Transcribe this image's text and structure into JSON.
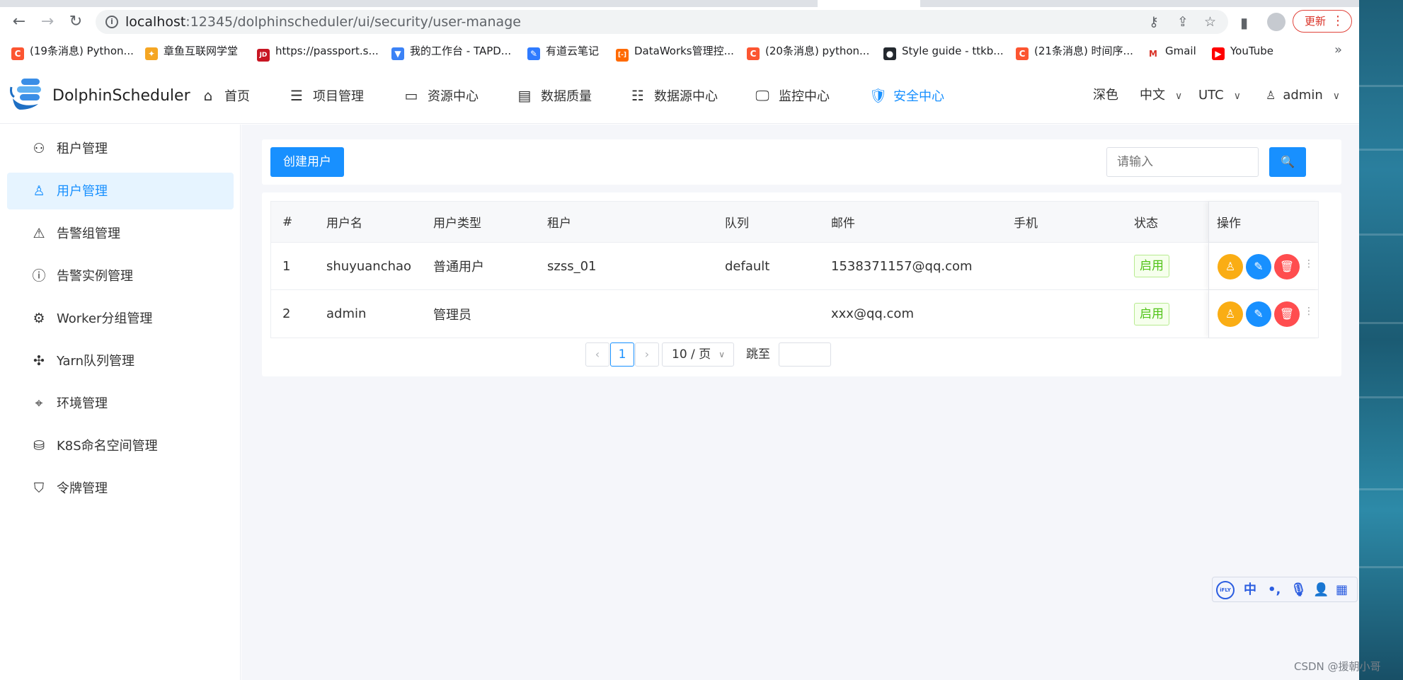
{
  "browser": {
    "nav": {
      "back": "←",
      "forward": "→",
      "reload": "↻"
    },
    "url_host": "localhost",
    "url_rest": ":12345/dolphinscheduler/ui/security/user-manage",
    "update_label": "更新",
    "bookmarks": [
      {
        "label": "(19条消息) Python...",
        "color": "#fc5531",
        "glyph": "C"
      },
      {
        "label": "章鱼互联网学堂",
        "color": "#f5a623",
        "glyph": "✦"
      },
      {
        "label": "https://passport.s...",
        "color": "#c81623",
        "glyph": "JD"
      },
      {
        "label": "我的工作台 - TAPD...",
        "color": "#3b82f6",
        "glyph": "▼"
      },
      {
        "label": "有道云笔记",
        "color": "#2f7bff",
        "glyph": "✎"
      },
      {
        "label": "DataWorks管理控...",
        "color": "#ff6a00",
        "glyph": "[-]"
      },
      {
        "label": "(20条消息) python...",
        "color": "#fc5531",
        "glyph": "C"
      },
      {
        "label": "Style guide - ttkb...",
        "color": "#24292f",
        "glyph": "●"
      },
      {
        "label": "(21条消息) 时间序...",
        "color": "#fc5531",
        "glyph": "C"
      },
      {
        "label": "Gmail",
        "color": "#ffffff",
        "glyph": "M"
      },
      {
        "label": "YouTube",
        "color": "#ff0000",
        "glyph": "▶"
      }
    ],
    "more": "»"
  },
  "app": {
    "brand": "DolphinScheduler",
    "nav": [
      {
        "label": "首页",
        "icon": "home-icon",
        "glyph": "⌂"
      },
      {
        "label": "项目管理",
        "icon": "project-icon",
        "glyph": "☰"
      },
      {
        "label": "资源中心",
        "icon": "folder-icon",
        "glyph": "▭"
      },
      {
        "label": "数据质量",
        "icon": "data-quality-icon",
        "glyph": "▤"
      },
      {
        "label": "数据源中心",
        "icon": "datasource-icon",
        "glyph": "☷"
      },
      {
        "label": "监控中心",
        "icon": "monitor-icon",
        "glyph": "🖵"
      },
      {
        "label": "安全中心",
        "icon": "shield-icon",
        "glyph": "🛡"
      }
    ],
    "theme_label": "深色",
    "language_label": "中文",
    "timezone_label": "UTC",
    "user_label": "admin"
  },
  "sidebar": {
    "items": [
      {
        "label": "租户管理",
        "icon": "tenant-icon",
        "glyph": "⚇"
      },
      {
        "label": "用户管理",
        "icon": "user-icon",
        "glyph": "♙"
      },
      {
        "label": "告警组管理",
        "icon": "warning-icon",
        "glyph": "⚠"
      },
      {
        "label": "告警实例管理",
        "icon": "info-icon",
        "glyph": "ⓘ"
      },
      {
        "label": "Worker分组管理",
        "icon": "worker-group-icon",
        "glyph": "⚙"
      },
      {
        "label": "Yarn队列管理",
        "icon": "yarn-queue-icon",
        "glyph": "✣"
      },
      {
        "label": "环境管理",
        "icon": "location-icon",
        "glyph": "⌖"
      },
      {
        "label": "K8S命名空间管理",
        "icon": "k8s-icon",
        "glyph": "⛁"
      },
      {
        "label": "令牌管理",
        "icon": "token-icon",
        "glyph": "⛉"
      }
    ]
  },
  "toolbar": {
    "create_user_label": "创建用户",
    "search_placeholder": "请输入",
    "search_icon": "🔍"
  },
  "table": {
    "columns": [
      "#",
      "用户名",
      "用户类型",
      "租户",
      "队列",
      "邮件",
      "手机",
      "状态",
      "操作"
    ],
    "rows": [
      {
        "index": "1",
        "username": "shuyuanchao",
        "user_type": "普通用户",
        "tenant": "szss_01",
        "queue": "default",
        "email": "1538371157@qq.com",
        "phone": "",
        "status": "启用",
        "more": "⋮"
      },
      {
        "index": "2",
        "username": "admin",
        "user_type": "管理员",
        "tenant": "",
        "queue": "",
        "email": "xxx@qq.com",
        "phone": "",
        "status": "启用",
        "more": "⋮"
      }
    ],
    "action_icons": {
      "authorize": "♙",
      "edit": "✎",
      "delete": "🗑"
    }
  },
  "pagination": {
    "prev": "‹",
    "current_page": "1",
    "next": "›",
    "page_size": "10 / 页",
    "jump_label": "跳至"
  },
  "ime": {
    "logo": "iFLY",
    "zh": "中",
    "punct": "•,",
    "mic": "🎙",
    "user": "👤",
    "apps": "▦"
  },
  "watermark": "CSDN @援朝小哥",
  "colors": {
    "primary": "#1890ff",
    "success": "#52c41a",
    "warning": "#faad14",
    "danger": "#ff4d4f"
  }
}
